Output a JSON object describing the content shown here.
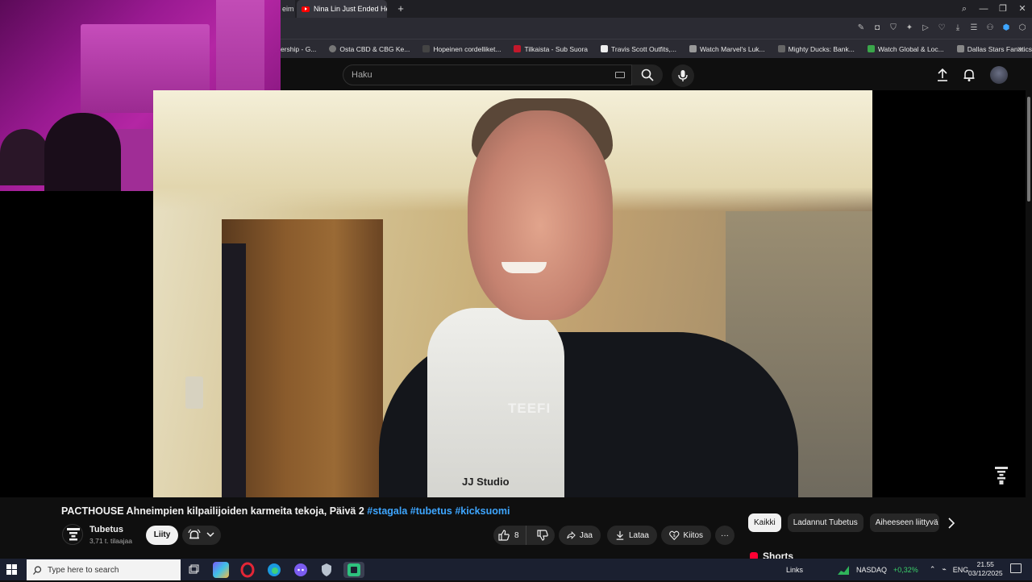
{
  "browser": {
    "partial_tab_label": "eim",
    "active_tab_title": "Nina Lin Just Ended Her C",
    "new_tab_label": "+",
    "window_controls": [
      "⌕",
      "—",
      "❐",
      "✕"
    ],
    "bookmarks": [
      {
        "label": "ership - G...",
        "color": "#555"
      },
      {
        "label": "Osta CBD & CBG Ke...",
        "color": "#777"
      },
      {
        "label": "Hopeinen cordelliket...",
        "color": "#444"
      },
      {
        "label": "Tilkaista - Sub Suora",
        "color": "#c2182b"
      },
      {
        "label": "Travis Scott Outfits,...",
        "color": "#eee"
      },
      {
        "label": "Watch Marvel's Luk...",
        "color": "#999"
      },
      {
        "label": "Mighty Ducks: Bank...",
        "color": "#666"
      },
      {
        "label": "Watch Global & Loc...",
        "color": "#3aa64a"
      },
      {
        "label": "Dallas Stars Fanatics...",
        "color": "#888"
      }
    ],
    "bookmarks_more": "»"
  },
  "youtube": {
    "search_placeholder": "Haku"
  },
  "video": {
    "watermark": "TEEFI",
    "shirt_text": "JJ Studio",
    "title_main": "PACTHOUSE Ahneimpien kilpailijoiden karmeita tekoja, Päivä 2 ",
    "title_tags": "#stagala #tubetus #kicksuomi",
    "channel_name": "Tubetus",
    "subscribers": "3,71 t. tilaajaa",
    "join_label": "Liity",
    "like_count": "8",
    "share_label": "Jaa",
    "download_label": "Lataa",
    "thanks_label": "Kiitos",
    "more_label": "···"
  },
  "sidebar": {
    "chips": [
      {
        "label": "Kaikki",
        "active": true
      },
      {
        "label": "Ladannut Tubetus",
        "active": false
      },
      {
        "label": "Aiheeseen liittyvä",
        "active": false
      }
    ],
    "shorts_label": "Shorts"
  },
  "taskbar": {
    "search_placeholder": "Type here to search",
    "links_label": "Links",
    "stock_name": "NASDAQ",
    "stock_change": "+0,32%",
    "language": "ENG",
    "time": "21.55",
    "date": "03/12/2025"
  },
  "colors": {
    "accent_link": "#3ea6ff",
    "youtube_red": "#ff0000",
    "webcam_tint": "#b426a4"
  }
}
